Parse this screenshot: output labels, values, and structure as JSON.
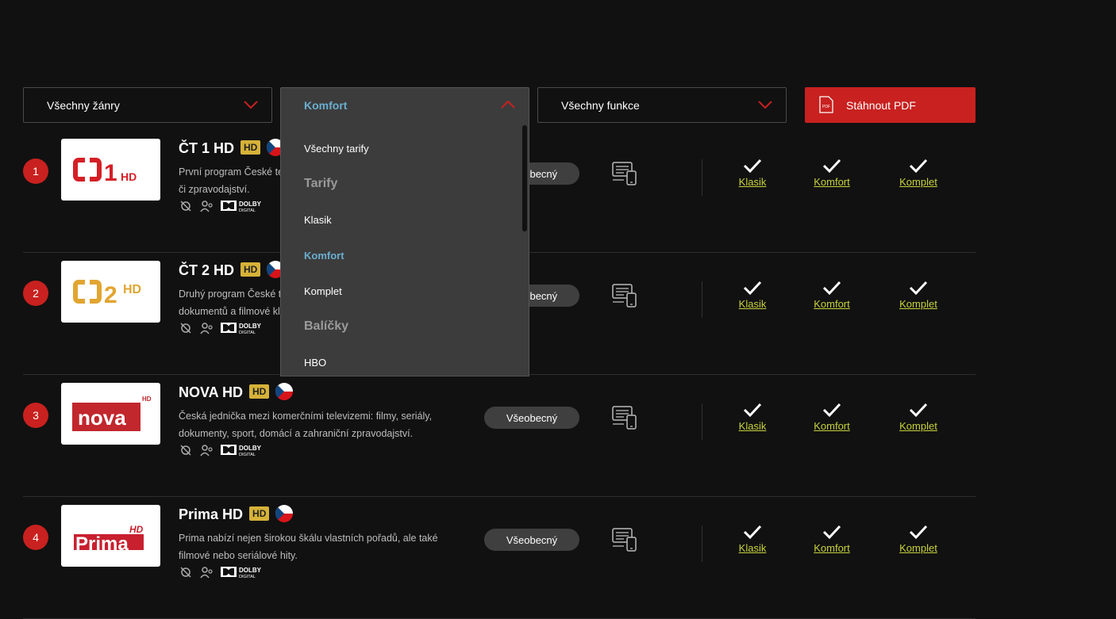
{
  "filters": {
    "genre": "Všechny žánry",
    "tariff": "Komfort",
    "features": "Všechny funkce",
    "pdf_button": "Stáhnout PDF",
    "pdf_icon_label": "PDF"
  },
  "tariff_dropdown": {
    "items": [
      {
        "label": "Všechny tarify",
        "kind": "option"
      },
      {
        "label": "Tarify",
        "kind": "group"
      },
      {
        "label": "Klasik",
        "kind": "option"
      },
      {
        "label": "Komfort",
        "kind": "selected"
      },
      {
        "label": "Komplet",
        "kind": "option"
      },
      {
        "label": "Balíčky",
        "kind": "group"
      },
      {
        "label": "HBO",
        "kind": "option"
      }
    ]
  },
  "channels": [
    {
      "num": "1",
      "name": "ČT 1 HD",
      "hd": "HD",
      "desc1": "První program České tel",
      "desc2": "či zpravodajství.",
      "genre": "Všeobecný",
      "logo": "1",
      "logo_hd": "HD"
    },
    {
      "num": "2",
      "name": "ČT 2 HD",
      "hd": "HD",
      "desc1": "Druhý program České te",
      "desc2": "dokumentů a filmové kl",
      "genre": "Všeobecný",
      "logo": "2",
      "logo_hd": "HD"
    },
    {
      "num": "3",
      "name": "NOVA HD",
      "hd": "HD",
      "desc1": "Česká jednička mezi komerčními televizemi: filmy, seriály,",
      "desc2": "dokumenty, sport, domácí a zahraniční zpravodajství.",
      "genre": "Všeobecný",
      "logo": "nova",
      "logo_hd": "HD"
    },
    {
      "num": "4",
      "name": "Prima HD",
      "hd": "HD",
      "desc1": "Prima nabízí nejen širokou škálu vlastních pořadů, ale také",
      "desc2": "filmové nebo seriálové hity.",
      "genre": "Všeobecný",
      "logo": "Prima",
      "logo_hd": "HD"
    }
  ],
  "tariffs": [
    "Klasik",
    "Komfort",
    "Komplet"
  ],
  "dolby": {
    "line1": "DOLBY",
    "line2": "DIGITAL"
  },
  "colors": {
    "accent_red": "#c8211f",
    "link_green": "#c8d23c",
    "selected_blue": "#6aaed0",
    "hd_badge": "#d6b238"
  }
}
